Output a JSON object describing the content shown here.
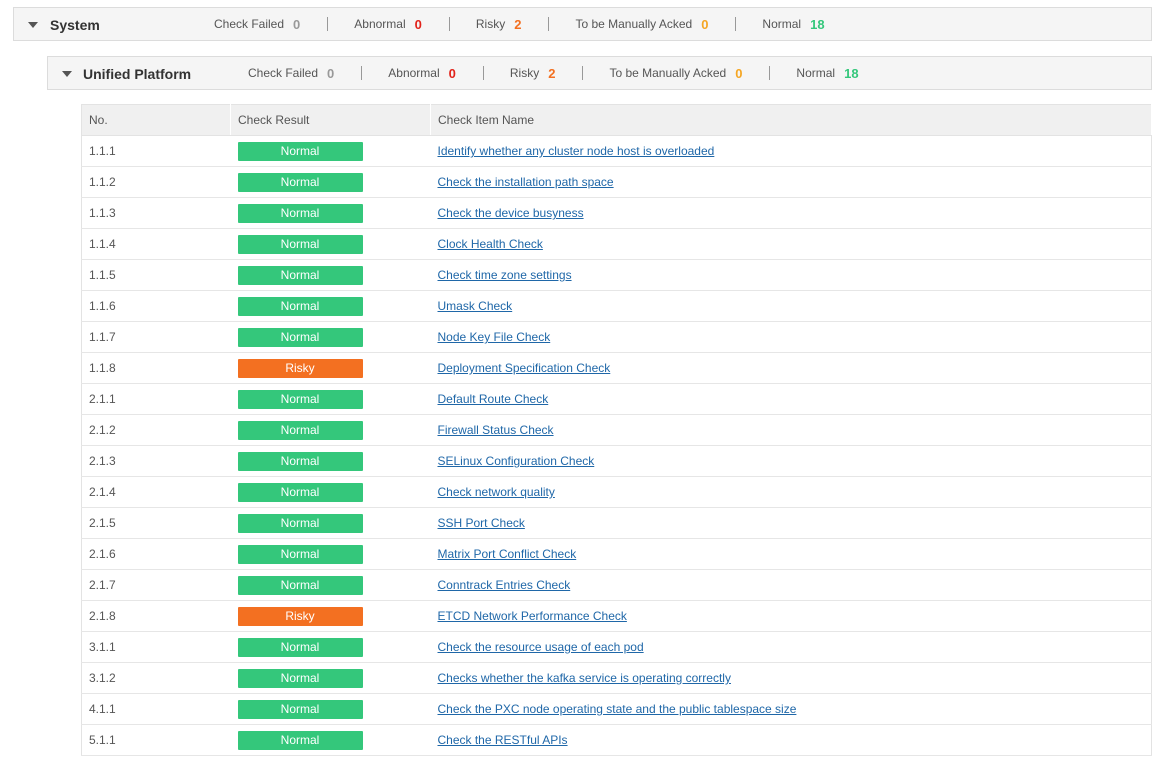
{
  "system": {
    "title": "System",
    "stats": {
      "check_failed_label": "Check Failed",
      "check_failed": "0",
      "abnormal_label": "Abnormal",
      "abnormal": "0",
      "risky_label": "Risky",
      "risky": "2",
      "acked_label": "To be Manually Acked",
      "acked": "0",
      "normal_label": "Normal",
      "normal": "18"
    }
  },
  "platform": {
    "title": "Unified Platform",
    "stats": {
      "check_failed_label": "Check Failed",
      "check_failed": "0",
      "abnormal_label": "Abnormal",
      "abnormal": "0",
      "risky_label": "Risky",
      "risky": "2",
      "acked_label": "To be Manually Acked",
      "acked": "0",
      "normal_label": "Normal",
      "normal": "18"
    }
  },
  "colors": {
    "normal": "#34c77b",
    "risky": "#f37021",
    "abnormal": "#e2231a",
    "acked": "#f5a623",
    "link": "#1f67a8"
  },
  "table": {
    "headers": {
      "no": "No.",
      "result": "Check Result",
      "name": "Check Item Name"
    },
    "rows": [
      {
        "no": "1.1.1",
        "result": "Normal",
        "name": "Identify whether any cluster node host is overloaded"
      },
      {
        "no": "1.1.2",
        "result": "Normal",
        "name": "Check the installation path space"
      },
      {
        "no": "1.1.3",
        "result": "Normal",
        "name": "Check the device busyness"
      },
      {
        "no": "1.1.4",
        "result": "Normal",
        "name": "Clock Health Check"
      },
      {
        "no": "1.1.5",
        "result": "Normal",
        "name": "Check time zone settings"
      },
      {
        "no": "1.1.6",
        "result": "Normal",
        "name": "Umask Check"
      },
      {
        "no": "1.1.7",
        "result": "Normal",
        "name": "Node Key File Check"
      },
      {
        "no": "1.1.8",
        "result": "Risky",
        "name": "Deployment Specification Check"
      },
      {
        "no": "2.1.1",
        "result": "Normal",
        "name": "Default Route Check"
      },
      {
        "no": "2.1.2",
        "result": "Normal",
        "name": "Firewall Status Check"
      },
      {
        "no": "2.1.3",
        "result": "Normal",
        "name": "SELinux Configuration Check"
      },
      {
        "no": "2.1.4",
        "result": "Normal",
        "name": "Check network quality"
      },
      {
        "no": "2.1.5",
        "result": "Normal",
        "name": "SSH Port Check"
      },
      {
        "no": "2.1.6",
        "result": "Normal",
        "name": "Matrix Port Conflict Check"
      },
      {
        "no": "2.1.7",
        "result": "Normal",
        "name": "Conntrack Entries Check"
      },
      {
        "no": "2.1.8",
        "result": "Risky",
        "name": "ETCD Network Performance Check"
      },
      {
        "no": "3.1.1",
        "result": "Normal",
        "name": "Check the resource usage of each pod"
      },
      {
        "no": "3.1.2",
        "result": "Normal",
        "name": "Checks whether the kafka service is operating correctly"
      },
      {
        "no": "4.1.1",
        "result": "Normal",
        "name": "Check the PXC node operating state and the public tablespace size"
      },
      {
        "no": "5.1.1",
        "result": "Normal",
        "name": "Check the RESTful APIs"
      }
    ]
  }
}
